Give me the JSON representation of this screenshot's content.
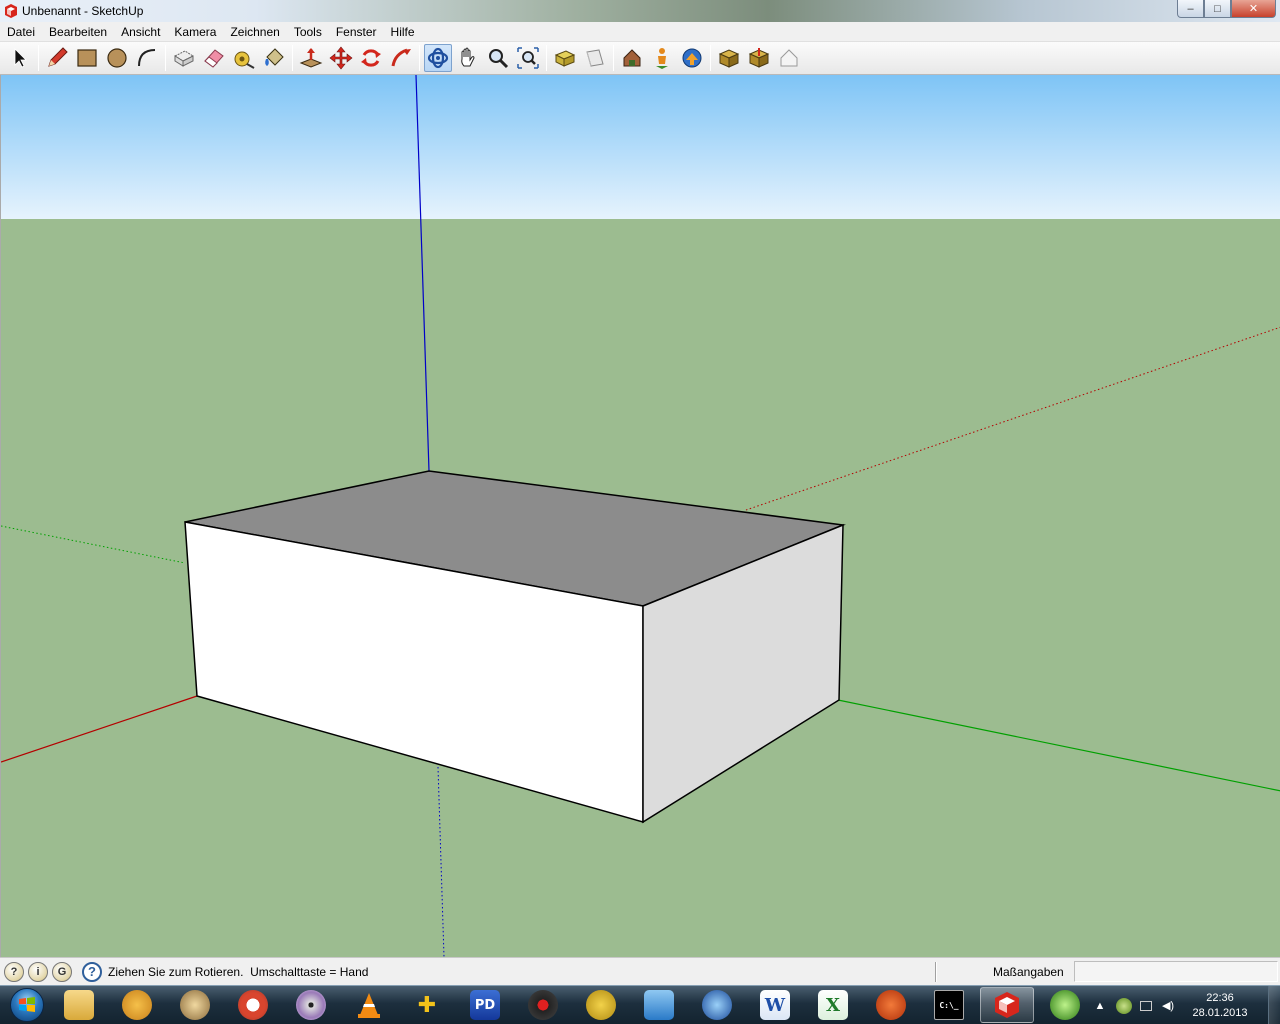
{
  "window": {
    "title": "Unbenannt - SketchUp",
    "controls": {
      "minimize": "–",
      "maximize": "□",
      "close": "✕"
    }
  },
  "menu": [
    "Datei",
    "Bearbeiten",
    "Ansicht",
    "Kamera",
    "Zeichnen",
    "Tools",
    "Fenster",
    "Hilfe"
  ],
  "toolbar": {
    "tools": [
      "select-tool",
      "line-tool",
      "rectangle-tool",
      "circle-tool",
      "arc-tool",
      "make-component-tool",
      "eraser-tool",
      "tape-measure-tool",
      "paint-bucket-tool",
      "push-pull-tool",
      "move-tool",
      "rotate-tool",
      "follow-me-tool",
      "orbit-tool",
      "pan-tool",
      "zoom-tool",
      "zoom-extents-tool",
      "previous-view-tool",
      "next-view-tool",
      "get-models-tool",
      "place-model-tool",
      "share-model-tool",
      "get-photo-texture-tool",
      "add-location-tool",
      "toggle-terrain-tool"
    ],
    "active_tool": "orbit-tool"
  },
  "colors": {
    "sky_top": "#7ec4f6",
    "sky_bottom": "#e6f3fd",
    "ground": "#9cbc90",
    "red_axis": "#b40000",
    "green_axis": "#00a000",
    "blue_axis": "#0000c8",
    "box_top": "#8c8c8c",
    "box_front": "#ffffff",
    "box_side": "#dcdcdc"
  },
  "status": {
    "message": "Ziehen Sie zum Rotieren.  Umschalttaste = Hand",
    "measurements_label": "Maßangaben",
    "measurements_value": ""
  },
  "taskbar": {
    "apps": [
      "explorer",
      "thunderbird",
      "gimp",
      "chrome",
      "dvd-player",
      "vlc",
      "playstation",
      "pd",
      "media",
      "clipgrab",
      "dropbox",
      "browser",
      "word",
      "excel",
      "firefox-fox",
      "cmd",
      "sketchup",
      "xbmc"
    ],
    "active_app": "sketchup",
    "time": "22:36",
    "date": "28.01.2013"
  }
}
